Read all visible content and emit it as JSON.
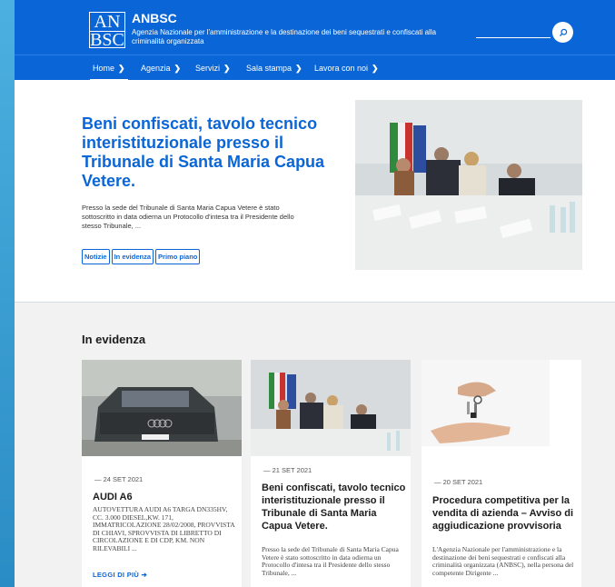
{
  "header": {
    "logo_line1": "AN",
    "logo_line2": "BSC",
    "site_name": "ANBSC",
    "site_description": "Agenzia Nazionale per l'amministrazione e la destinazione dei beni sequestrati e confiscati alla criminalità organizzata",
    "search_icon": "search-icon"
  },
  "nav": {
    "items": [
      {
        "label": "Home"
      },
      {
        "label": "Agenzia"
      },
      {
        "label": "Servizi"
      },
      {
        "label": "Sala stampa"
      },
      {
        "label": "Lavora con noi"
      }
    ]
  },
  "hero": {
    "title": "Beni confiscati, tavolo tecnico interistituzionale presso il Tribunale di Santa Maria Capua Vetere.",
    "excerpt": "Presso la sede del Tribunale di Santa Maria Capua Vetere è stato sottoscritto in data odierna un Protocollo d'intesa tra il Presidente dello stesso Tribunale, ...",
    "tags": [
      "Notizie",
      "In evidenza",
      "Primo piano"
    ]
  },
  "evidenza": {
    "title": "In evidenza",
    "cards": [
      {
        "date": "— 24 SET 2021",
        "title": "AUDI A6",
        "text": "AUTOVETTURA AUDI A6 TARGA DN335HV, CC. 3.000 DIESEL,KW. 171, IMMATRICOLAZIONE 28/02/2008, PROVVISTA DI CHIAVI, SPROVVISTA DI LIBRETTO DI CIRCOLAZIONE E DI CDP, KM. NON RILEVABILI ...",
        "link": "LEGGI DI PIÙ"
      },
      {
        "date": "— 21 SET 2021",
        "title": "Beni confiscati, tavolo tecnico interistituzionale presso il Tribunale di Santa Maria Capua Vetere.",
        "text": "Presso la sede del Tribunale di Santa Maria Capua Vetere è stato sottoscritto in data odierna un Protocollo d'intesa tra il Presidente dello stesso Tribunale, ..."
      },
      {
        "date": "— 20 SET 2021",
        "title": "Procedura competitiva per la vendita di azienda – Avviso di aggiudicazione provvisoria",
        "text": "L'Agenzia Nazionale per l'amministrazione e la destinazione dei beni sequestrati e confiscati alla criminalità organizzata (ANBSC), nella persona del competente Dirigente ..."
      }
    ]
  },
  "colors": {
    "brand_blue": "#0a66d6",
    "side_strip": "#3aa2d6"
  }
}
